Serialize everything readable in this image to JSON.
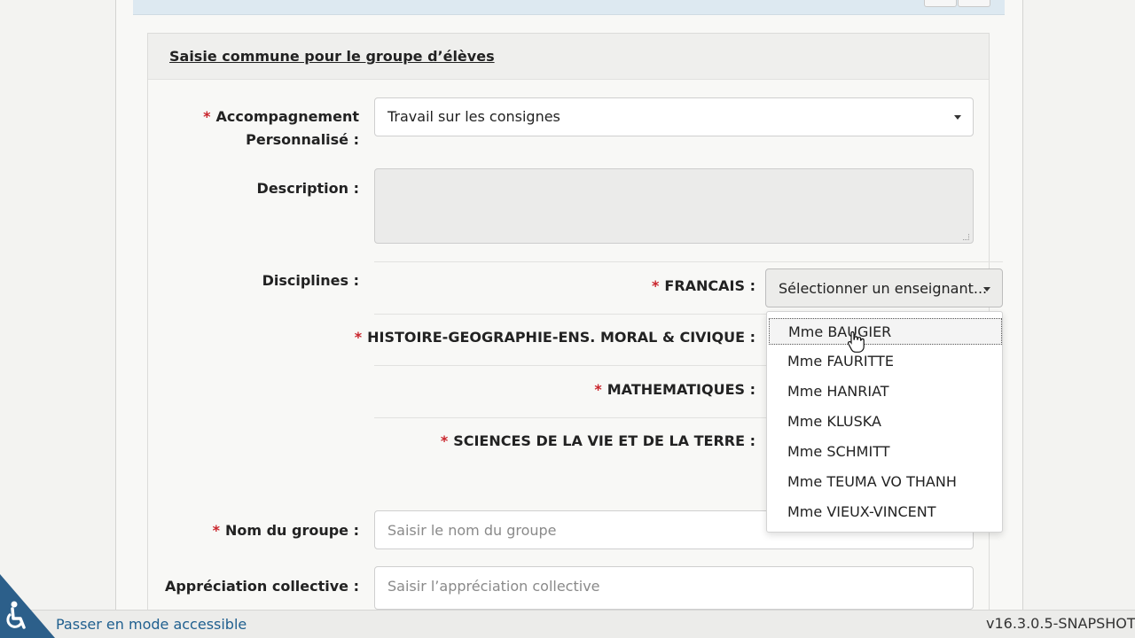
{
  "panel": {
    "title": "Saisie commune pour le groupe d’élèves"
  },
  "colors": {
    "required": "#c9242b",
    "link": "#1f5f8f",
    "accessible_badge": "#2c5f8a"
  },
  "form": {
    "accompagnement": {
      "label_line1": "Accompagnement",
      "label_line2": "Personnalisé :",
      "required_marker": "*",
      "value": "Travail sur les consignes"
    },
    "description": {
      "label": "Description :",
      "value": ""
    },
    "disciplines": {
      "label": "Disciplines :",
      "items": [
        {
          "name": "FRANCAIS :",
          "required_marker": "*"
        },
        {
          "name": "HISTOIRE-GEOGRAPHIE-ENS. MORAL & CIVIQUE :",
          "required_marker": "*"
        },
        {
          "name": "MATHEMATIQUES :",
          "required_marker": "*"
        },
        {
          "name": "SCIENCES DE LA VIE ET DE LA TERRE :",
          "required_marker": "*"
        }
      ],
      "teacher_select": {
        "label": "Sélectionner un enseignant...",
        "options": [
          "Mme BAUGIER",
          "Mme FAURITTE",
          "Mme HANRIAT",
          "Mme KLUSKA",
          "Mme SCHMITT",
          "Mme TEUMA VO THANH",
          "Mme VIEUX-VINCENT"
        ],
        "focused_option": "Mme BAUGIER"
      }
    },
    "nom_groupe": {
      "label": "Nom du groupe :",
      "required_marker": "*",
      "placeholder": "Saisir le nom du groupe"
    },
    "appreciation": {
      "label": "Appréciation collective :",
      "placeholder": "Saisir l’appréciation collective"
    }
  },
  "footer": {
    "accessible_link": "Passer en mode accessible",
    "version": "v16.3.0.5-SNAPSHOT",
    "accessibility_icon": "wheelchair-icon"
  }
}
